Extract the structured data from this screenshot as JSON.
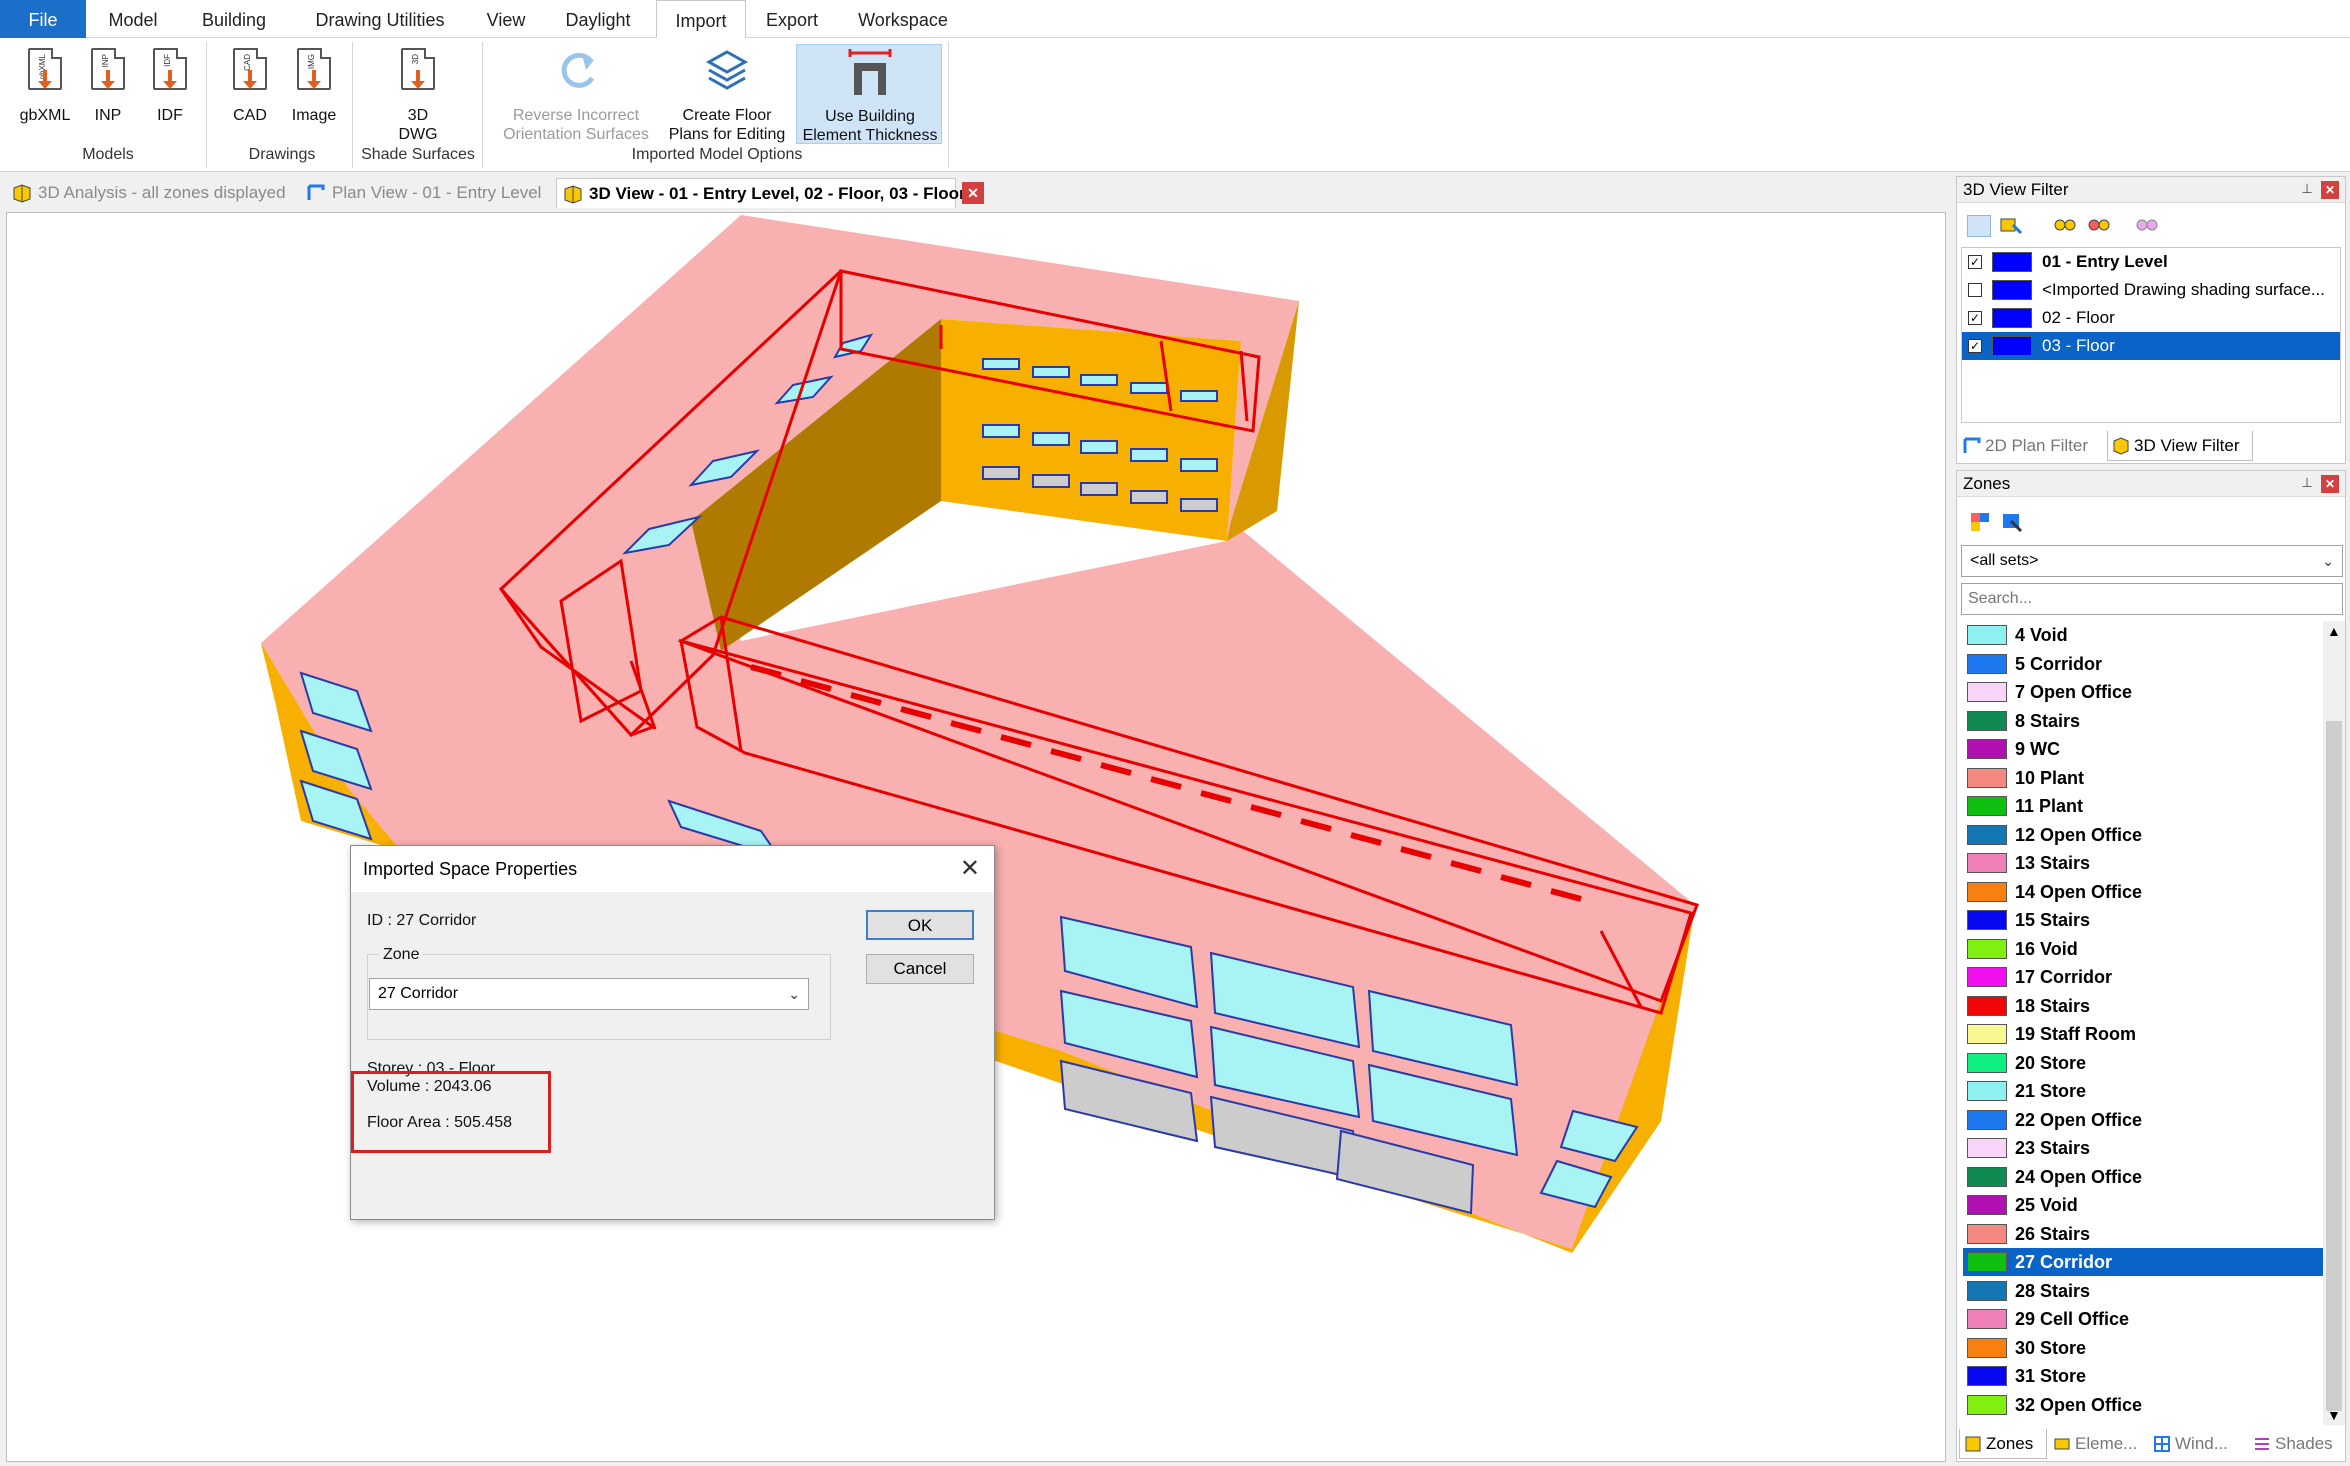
{
  "menu": {
    "tabs": [
      "File",
      "Model",
      "Building",
      "Drawing Utilities",
      "View",
      "Daylight",
      "Import",
      "Export",
      "Workspace"
    ],
    "active": "Import"
  },
  "ribbon": {
    "groups": {
      "models": "Models",
      "drawings": "Drawings",
      "shade": "Shade Surfaces",
      "imported": "Imported Model Options"
    },
    "buttons": {
      "gbxml": "gbXML",
      "inp": "INP",
      "idf": "IDF",
      "cad": "CAD",
      "image": "Image",
      "dwg_line1": "3D",
      "dwg_line2": "DWG",
      "reverse_line1": "Reverse Incorrect",
      "reverse_line2": "Orientation Surfaces",
      "create_line1": "Create Floor",
      "create_line2": "Plans for Editing",
      "use_line1": "Use Building",
      "use_line2": "Element Thickness"
    },
    "icon_tags": {
      "gbxml": "gbXML",
      "inp": "INP",
      "idf": "IDF",
      "cad": "CAD",
      "img": "IMG",
      "dwg": "3D"
    }
  },
  "doctabs": [
    {
      "label": "3D Analysis - all zones displayed",
      "active": false
    },
    {
      "label": "Plan View - 01 - Entry Level",
      "active": false
    },
    {
      "label": "3D View - 01 - Entry Level, 02 - Floor, 03 - Floor",
      "active": true
    }
  ],
  "dialog": {
    "title": "Imported Space Properties",
    "id_line": "ID   : 27 Corridor",
    "zone_group": "Zone",
    "zone_value": "27 Corridor",
    "storey_line": "Storey : 03 - Floor",
    "volume_line": "Volume : 2043.06",
    "area_line": "Floor Area : 505.458",
    "ok": "OK",
    "cancel": "Cancel"
  },
  "view_filter": {
    "title": "3D View Filter",
    "items": [
      {
        "label": "01 - Entry Level",
        "checked": true,
        "bold": true
      },
      {
        "label": "<Imported Drawing shading surface...",
        "checked": false,
        "bold": false
      },
      {
        "label": "02 - Floor",
        "checked": true,
        "bold": false
      },
      {
        "label": "03 - Floor",
        "checked": true,
        "bold": false,
        "selected": true
      }
    ],
    "tab_2d": "2D Plan Filter",
    "tab_3d": "3D View Filter"
  },
  "zones_panel": {
    "title": "Zones",
    "set_value": "<all sets>",
    "search_placeholder": "Search...",
    "items": [
      {
        "label": "4 Void",
        "color": "#8ff0f0"
      },
      {
        "label": "5 Corridor",
        "color": "#1e78f0"
      },
      {
        "label": "7 Open Office",
        "color": "#f8d4f8"
      },
      {
        "label": "8 Stairs",
        "color": "#108a50"
      },
      {
        "label": "9 WC",
        "color": "#b010b0"
      },
      {
        "label": "10 Plant",
        "color": "#f48880"
      },
      {
        "label": "11 Plant",
        "color": "#10c010"
      },
      {
        "label": "12 Open Office",
        "color": "#1478b4"
      },
      {
        "label": "13 Stairs",
        "color": "#f080b8"
      },
      {
        "label": "14 Open Office",
        "color": "#f88010"
      },
      {
        "label": "15 Stairs",
        "color": "#0808f0"
      },
      {
        "label": "16 Void",
        "color": "#80f010"
      },
      {
        "label": "17 Corridor",
        "color": "#f010f0"
      },
      {
        "label": "18 Stairs",
        "color": "#f00808"
      },
      {
        "label": "19 Staff Room",
        "color": "#f8f890"
      },
      {
        "label": "20 Store",
        "color": "#10f080"
      },
      {
        "label": "21 Store",
        "color": "#8ff0f0"
      },
      {
        "label": "22 Open Office",
        "color": "#1e78f0"
      },
      {
        "label": "23 Stairs",
        "color": "#f8d4f8"
      },
      {
        "label": "24 Open Office",
        "color": "#108a50"
      },
      {
        "label": "25 Void",
        "color": "#b010b0"
      },
      {
        "label": "26 Stairs",
        "color": "#f48880"
      },
      {
        "label": "27 Corridor",
        "color": "#10c010",
        "selected": true
      },
      {
        "label": "28 Stairs",
        "color": "#1478b4"
      },
      {
        "label": "29 Cell Office",
        "color": "#f080b8"
      },
      {
        "label": "30 Store",
        "color": "#f88010"
      },
      {
        "label": "31 Store",
        "color": "#0808f0"
      },
      {
        "label": "32 Open Office",
        "color": "#80f010"
      }
    ],
    "bottom_tabs": [
      "Zones",
      "Eleme...",
      "Wind...",
      "Shades"
    ]
  },
  "colors": {
    "accent": "#0a64c8",
    "roof": "#f8b0b0",
    "wall": "#f8b000",
    "selection_outline": "#e80000",
    "glazing": "#a8f4f4"
  }
}
